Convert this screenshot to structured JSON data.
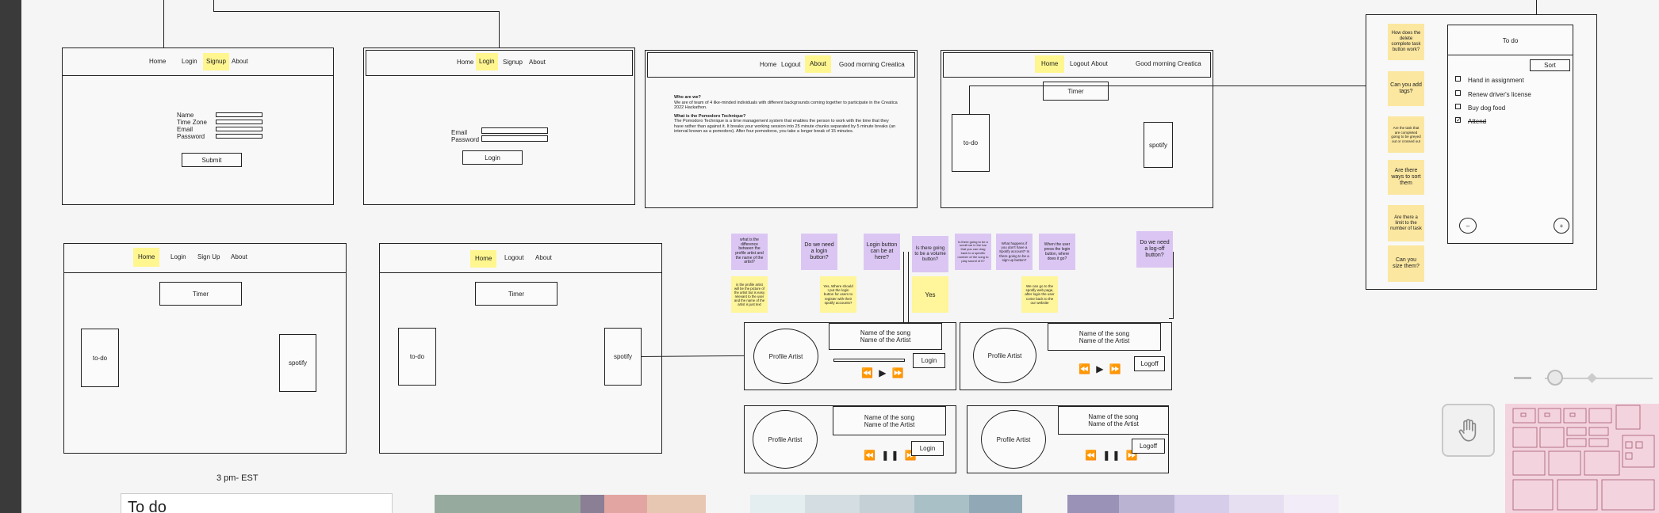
{
  "wire1": {
    "nav": [
      "Home",
      "Login",
      "Signup",
      "About"
    ],
    "form": [
      "Name",
      "Time Zone",
      "Email",
      "Password"
    ],
    "submit": "Submit"
  },
  "wire2": {
    "nav": [
      "Home",
      "Login",
      "Signup",
      "About"
    ],
    "form": [
      "Email",
      "Password"
    ],
    "login": "Login"
  },
  "wire3": {
    "nav": [
      "Home",
      "Logout",
      "About"
    ],
    "greeting": "Good morning Creatica",
    "q1": "Who are we?",
    "p1": "We are of team of 4 like-minded individuals with different backgrounds coming together to participate in the Creatica 2022 Hackathon.",
    "q2": "What is the Pomodoro Technique?",
    "p2": "The Pomodoro Technique is a time management system that enables the person to work with the time that they have rather than against it. It breaks your working session into 25 minute chunks separated by 5 minute breaks (an interval known as a pomodoro). After four pomodoros, you take a longer break of 15 minutes."
  },
  "wire4": {
    "nav": [
      "Home",
      "Logout",
      "About"
    ],
    "greeting": "Good morning Creatica",
    "timer": "Timer",
    "todo": "to-do",
    "spotify": "spotify"
  },
  "wire5": {
    "nav": [
      "Home",
      "Login",
      "Sign Up",
      "About"
    ],
    "timer": "Timer",
    "todo": "to-do",
    "spotify": "spotify"
  },
  "wire6": {
    "nav": [
      "Home",
      "Logout",
      "About"
    ],
    "timer": "Timer",
    "todo": "to-do",
    "spotify": "spotify"
  },
  "todo_stickies": [
    "How does the delete complete task button work?",
    "Can you add tags?",
    "Are the task that are completed going to be greyed out or crossed out",
    "Are there ways to sort them",
    "Are there a limit to the number of task",
    "Can you size them?"
  ],
  "todo_phone": {
    "title": "To do",
    "sort": "Sort",
    "tasks": [
      "Hand in assignment",
      "Renew driver's license",
      "Buy dog food",
      "Attend"
    ],
    "minus": "–",
    "plus": "+"
  },
  "spotify_stickies": {
    "q1": "what is the difference between the profile artist and the name of the artist?",
    "a1": "is the profile artist will be the picture of the artist but is easy relevant to the user and the name of the artist is just text",
    "q2": "Do we need a login button?",
    "a2": "Yes, Where should I put the login button for users to register with their spotify accounts?",
    "q3": "Login button can be at here?",
    "q4": "Is there going to be a volume button?",
    "a4": "Yes",
    "q5": "Is there going to be a scroll bar in the bar that you can drag back to a specific number of the song to play sound of it?",
    "q6": "What happens if you don't have a Spotify account? Is there going to be a sign up button?",
    "q7": "When the user press the login button, where does it go?",
    "a7": "We can go to the spotify web page, after login the user come back to the our website",
    "q8": "Do we need a log-off button?"
  },
  "players": [
    {
      "profile": "Profile Artist",
      "song": "Name of the song",
      "artist": "Name of the Artist",
      "button": "Login"
    },
    {
      "profile": "Profile Artist",
      "song": "Name of the song",
      "artist": "Name of the Artist",
      "button": "Logoff"
    },
    {
      "profile": "Profile Artist",
      "song": "Name of the song",
      "artist": "Name of the Artist",
      "button": "Login"
    },
    {
      "profile": "Profile Artist",
      "song": "Name of the song",
      "artist": "Name of the Artist",
      "button": "Logoff"
    }
  ],
  "time_note": "3 pm- EST",
  "bottom_card_title": "To do",
  "swatch_colors": [
    "#97aa9e",
    "#8a7f95",
    "#e3a5a2",
    "#e8c7b2",
    "#e4eef0",
    "#d4dde1",
    "#c4d0d5",
    "#a9c0c6",
    "#91a9b6",
    "#9b92b8",
    "#bbb3d2",
    "#d5cdea",
    "#e6dff2",
    "#f1ecf7"
  ],
  "accent": "#fff68f"
}
